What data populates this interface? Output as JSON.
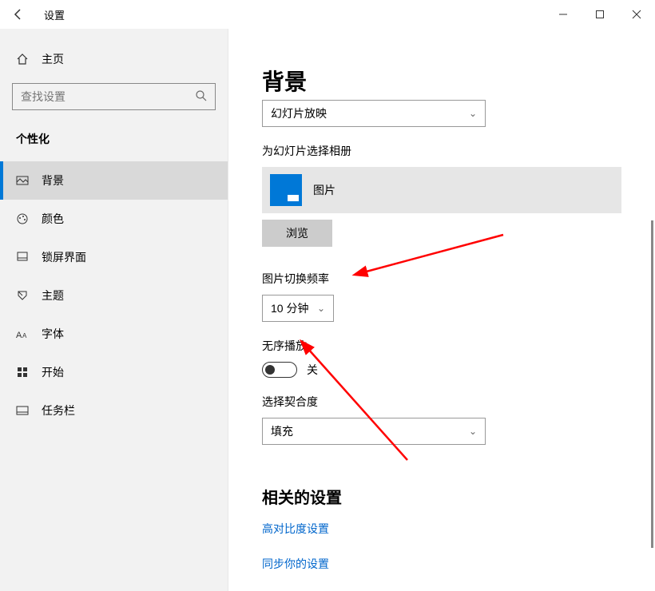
{
  "titlebar": {
    "title": "设置"
  },
  "sidebar": {
    "home": "主页",
    "search_placeholder": "查找设置",
    "category": "个性化",
    "items": [
      {
        "label": "背景"
      },
      {
        "label": "颜色"
      },
      {
        "label": "锁屏界面"
      },
      {
        "label": "主题"
      },
      {
        "label": "字体"
      },
      {
        "label": "开始"
      },
      {
        "label": "任务栏"
      }
    ]
  },
  "main": {
    "page_title": "背景",
    "bg_mode_selected": "幻灯片放映",
    "album_label": "为幻灯片选择相册",
    "album_name": "图片",
    "browse_label": "浏览",
    "interval_label": "图片切换频率",
    "interval_selected": "10 分钟",
    "shuffle_label": "无序播放",
    "shuffle_state": "关",
    "fit_label": "选择契合度",
    "fit_selected": "填充",
    "related_title": "相关的设置",
    "link_contrast": "高对比度设置",
    "link_sync": "同步你的设置"
  }
}
